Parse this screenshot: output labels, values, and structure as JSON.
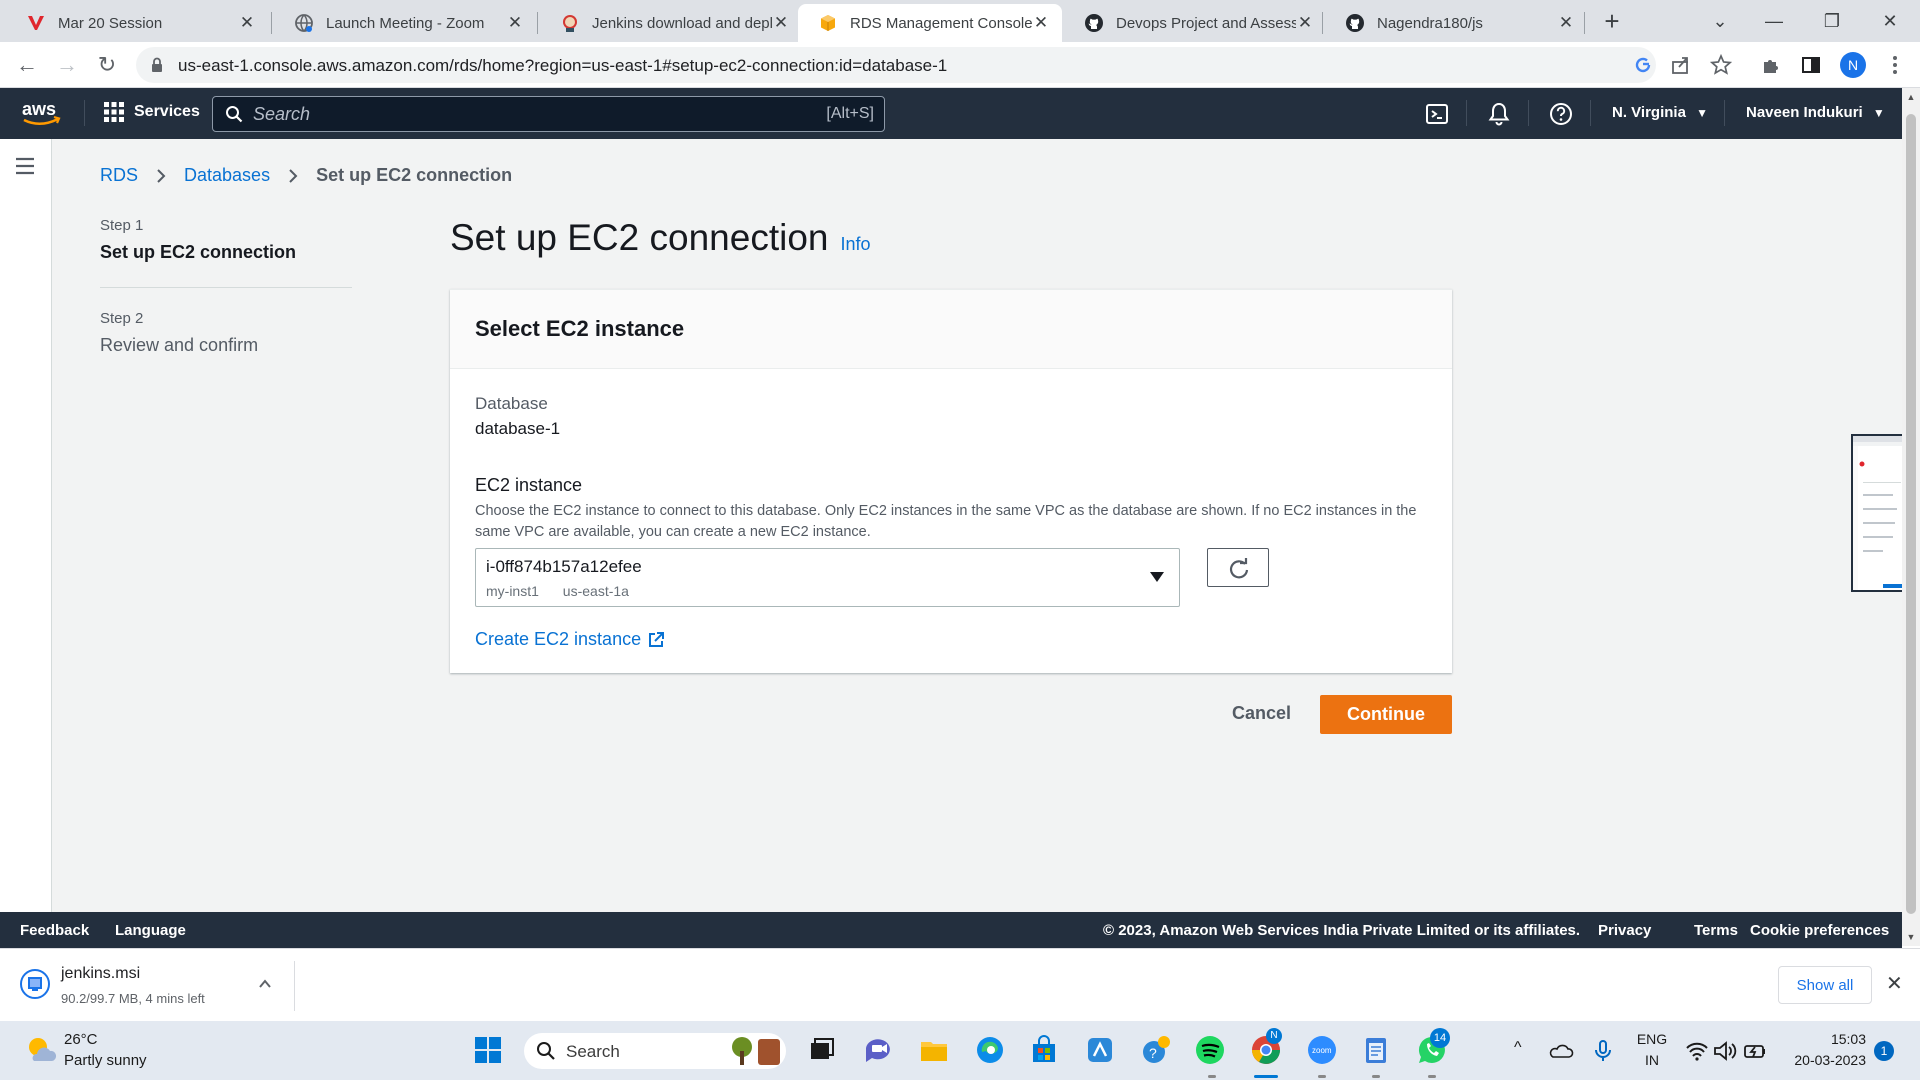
{
  "browser": {
    "tabs": [
      {
        "title": "Mar 20 Session"
      },
      {
        "title": "Launch Meeting - Zoom"
      },
      {
        "title": "Jenkins download and depl"
      },
      {
        "title": "RDS Management Console"
      },
      {
        "title": "Devops Project and Assessr"
      },
      {
        "title": "Nagendra180/js"
      }
    ],
    "url": "us-east-1.console.aws.amazon.com/rds/home?region=us-east-1#setup-ec2-connection:id=database-1",
    "profile_initial": "N"
  },
  "aws_nav": {
    "logo_text": "aws",
    "services_label": "Services",
    "search_placeholder": "Search",
    "search_shortcut": "[Alt+S]",
    "region": "N. Virginia",
    "user": "Naveen Indukuri"
  },
  "breadcrumb": {
    "items": [
      "RDS",
      "Databases"
    ],
    "current": "Set up EC2 connection"
  },
  "steps": [
    {
      "number": "Step 1",
      "title": "Set up EC2 connection"
    },
    {
      "number": "Step 2",
      "title": "Review and confirm"
    }
  ],
  "page": {
    "title": "Set up EC2 connection",
    "info_link": "Info"
  },
  "card": {
    "header": "Select EC2 instance",
    "database_label": "Database",
    "database_value": "database-1",
    "ec2_label": "EC2 instance",
    "ec2_description": "Choose the EC2 instance to connect to this database. Only EC2 instances in the same VPC as the database are shown. If no EC2 instances in the same VPC are available, you can create a new EC2 instance.",
    "selected_instance": {
      "id": "i-0ff874b157a12efee",
      "name": "my-inst1",
      "zone": "us-east-1a"
    },
    "create_link": "Create EC2 instance"
  },
  "actions": {
    "cancel": "Cancel",
    "continue": "Continue"
  },
  "footer": {
    "feedback": "Feedback",
    "language": "Language",
    "copyright": "© 2023, Amazon Web Services India Private Limited or its affiliates.",
    "privacy": "Privacy",
    "terms": "Terms",
    "cookies": "Cookie preferences"
  },
  "download": {
    "filename": "jenkins.msi",
    "status": "90.2/99.7 MB, 4 mins left",
    "show_all": "Show all"
  },
  "taskbar": {
    "temperature": "26°C",
    "weather": "Partly sunny",
    "search_label": "Search",
    "whatsapp_badge": "14",
    "chrome_badge": "N",
    "lang_line1": "ENG",
    "lang_line2": "IN",
    "time": "15:03",
    "date": "20-03-2023",
    "notification_count": "1"
  },
  "colors": {
    "aws_nav": "#232f3e",
    "primary_button": "#ec7211",
    "link": "#0972d3"
  }
}
